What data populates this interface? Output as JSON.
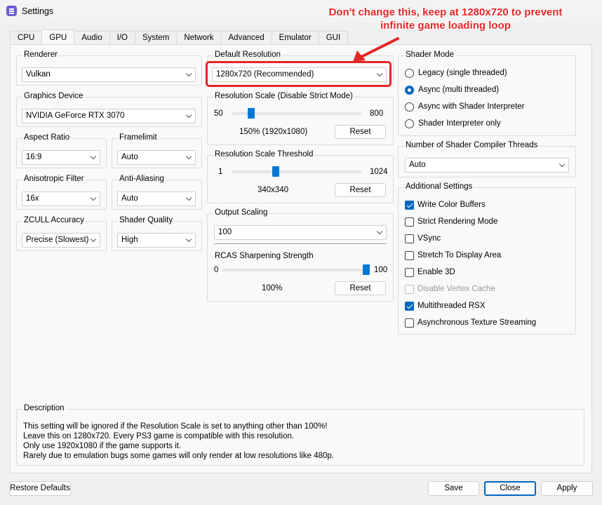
{
  "window": {
    "title": "Settings",
    "icon": "settings-app-icon"
  },
  "annotation": {
    "line1": "Don't change this, keep at 1280x720 to prevent",
    "line2": "infinite game loading loop",
    "color": "#e32626"
  },
  "tabs": [
    "CPU",
    "GPU",
    "Audio",
    "I/O",
    "System",
    "Network",
    "Advanced",
    "Emulator",
    "GUI"
  ],
  "active_tab": "GPU",
  "renderer": {
    "label": "Renderer",
    "value": "Vulkan"
  },
  "graphics_device": {
    "label": "Graphics Device",
    "value": "NVIDIA GeForce RTX 3070"
  },
  "aspect_ratio": {
    "label": "Aspect Ratio",
    "value": "16:9"
  },
  "framelimit": {
    "label": "Framelimit",
    "value": "Auto"
  },
  "anisotropic": {
    "label": "Anisotropic Filter",
    "value": "16x"
  },
  "anti_aliasing": {
    "label": "Anti-Aliasing",
    "value": "Auto"
  },
  "zcull": {
    "label": "ZCULL Accuracy",
    "value": "Precise (Slowest)"
  },
  "shader_quality": {
    "label": "Shader Quality",
    "value": "High"
  },
  "default_resolution": {
    "label": "Default Resolution",
    "value": "1280x720 (Recommended)"
  },
  "resolution_scale": {
    "label": "Resolution Scale (Disable Strict Mode)",
    "min": "50",
    "max": "800",
    "value": 150,
    "value_text": "150% (1920x1080)",
    "reset": "Reset"
  },
  "scale_threshold": {
    "label": "Resolution Scale Threshold",
    "min": "1",
    "max": "1024",
    "value": 340,
    "value_text": "340x340",
    "reset": "Reset"
  },
  "output_scaling": {
    "label": "Output Scaling",
    "value": 100,
    "rcas_label": "RCAS Sharpening Strength",
    "min": "0",
    "max": "100",
    "value_text": "100%",
    "reset": "Reset"
  },
  "shader_mode": {
    "label": "Shader Mode",
    "options": [
      {
        "label": "Legacy (single threaded)",
        "selected": false
      },
      {
        "label": "Async (multi threaded)",
        "selected": true
      },
      {
        "label": "Async with Shader Interpreter",
        "selected": false
      },
      {
        "label": "Shader Interpreter only",
        "selected": false
      }
    ]
  },
  "compiler_threads": {
    "label": "Number of Shader Compiler Threads",
    "value": "Auto"
  },
  "additional": {
    "label": "Additional Settings",
    "items": [
      {
        "label": "Write Color Buffers",
        "checked": true,
        "disabled": false
      },
      {
        "label": "Strict Rendering Mode",
        "checked": false,
        "disabled": false
      },
      {
        "label": "VSync",
        "checked": false,
        "disabled": false
      },
      {
        "label": "Stretch To Display Area",
        "checked": false,
        "disabled": false
      },
      {
        "label": "Enable 3D",
        "checked": false,
        "disabled": false
      },
      {
        "label": "Disable Vertex Cache",
        "checked": false,
        "disabled": true
      },
      {
        "label": "Multithreaded RSX",
        "checked": true,
        "disabled": false
      },
      {
        "label": "Asynchronous Texture Streaming",
        "checked": false,
        "disabled": false
      }
    ]
  },
  "description": {
    "label": "Description",
    "lines": [
      "This setting will be ignored if the Resolution Scale is set to anything other than 100%!",
      "Leave this on 1280x720. Every PS3 game is compatible with this resolution.",
      "Only use 1920x1080 if the game supports it.",
      "Rarely due to emulation bugs some games will only render at low resolutions like 480p."
    ]
  },
  "buttons": {
    "restore": "Restore Defaults",
    "save": "Save",
    "close": "Close",
    "apply": "Apply"
  },
  "accent_color": "#0078d4"
}
